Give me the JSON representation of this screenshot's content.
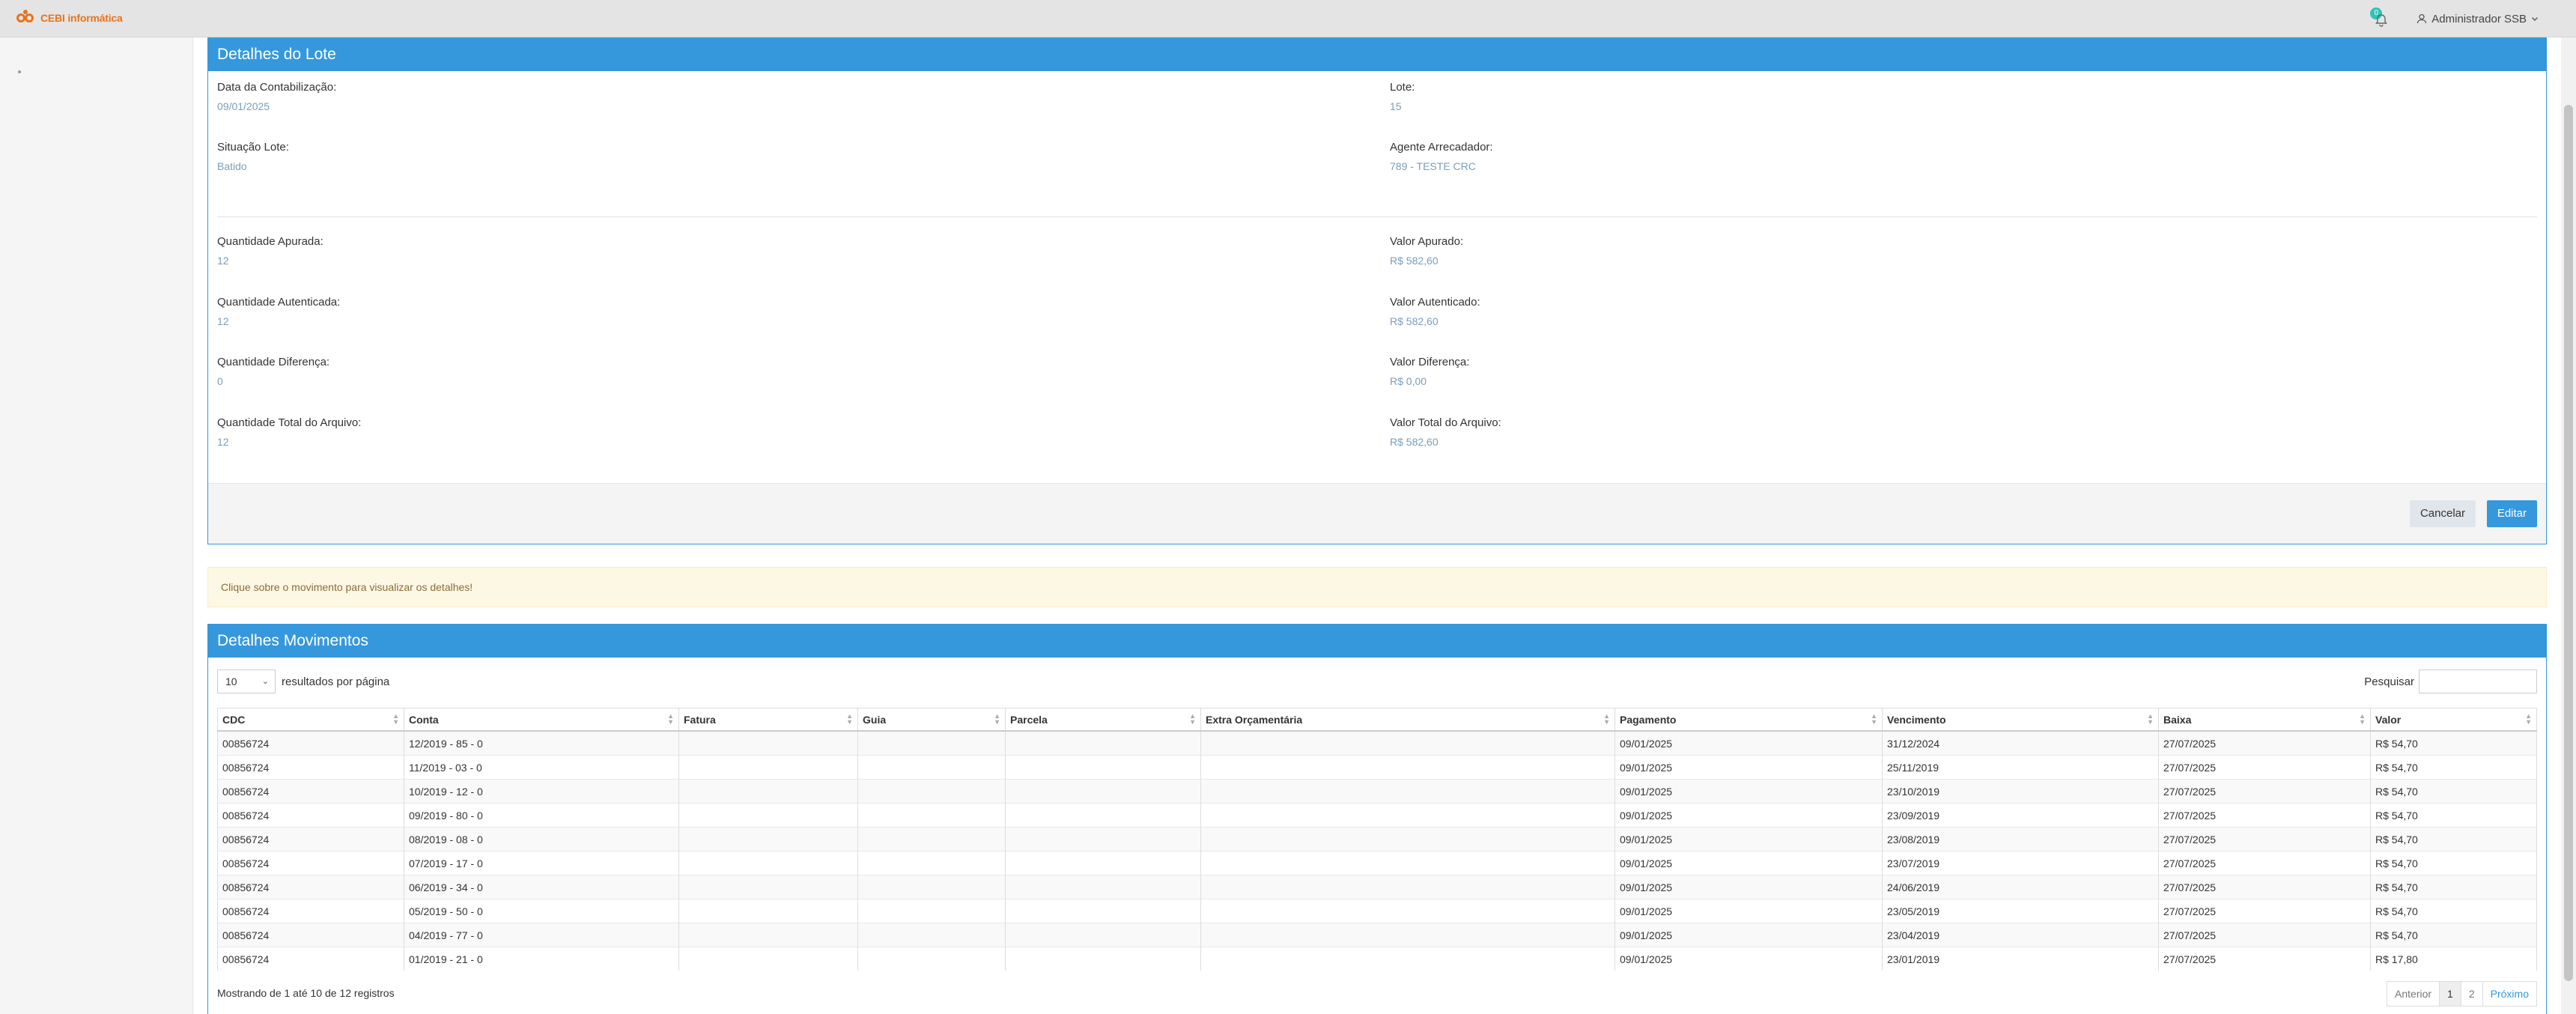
{
  "navbar": {
    "brand": "CEBI informática",
    "notification_count": "0",
    "user_name": "Administrador SSB"
  },
  "lote": {
    "title": "Detalhes do Lote",
    "fields": [
      {
        "label": "Data da Contabilização:",
        "value": "09/01/2025"
      },
      {
        "label": "Lote:",
        "value": "15"
      },
      {
        "label": "Situação Lote:",
        "value": "Batido"
      },
      {
        "label": "Agente Arrecadador:",
        "value": "789 - TESTE CRC"
      },
      {
        "label": "Quantidade Apurada:",
        "value": "12"
      },
      {
        "label": "Valor Apurado:",
        "value": "R$ 582,60"
      },
      {
        "label": "Quantidade Autenticada:",
        "value": "12"
      },
      {
        "label": "Valor Autenticado:",
        "value": "R$ 582,60"
      },
      {
        "label": "Quantidade Diferença:",
        "value": "0"
      },
      {
        "label": "Valor Diferença:",
        "value": "R$ 0,00"
      },
      {
        "label": "Quantidade Total do Arquivo:",
        "value": "12"
      },
      {
        "label": "Valor Total do Arquivo:",
        "value": "R$ 582,60"
      }
    ],
    "cancel_label": "Cancelar",
    "edit_label": "Editar"
  },
  "alert_text": "Clique sobre o movimento para visualizar os detalhes!",
  "movimentos": {
    "title": "Detalhes Movimentos",
    "page_length": "10",
    "page_length_label": "resultados por página",
    "search_label": "Pesquisar",
    "columns": [
      "CDC",
      "Conta",
      "Fatura",
      "Guia",
      "Parcela",
      "Extra Orçamentária",
      "Pagamento",
      "Vencimento",
      "Baixa",
      "Valor"
    ],
    "rows": [
      [
        "00856724",
        "12/2019 - 85 - 0",
        "",
        "",
        "",
        "",
        "09/01/2025",
        "31/12/2024",
        "27/07/2025",
        "R$ 54,70"
      ],
      [
        "00856724",
        "11/2019 - 03 - 0",
        "",
        "",
        "",
        "",
        "09/01/2025",
        "25/11/2019",
        "27/07/2025",
        "R$ 54,70"
      ],
      [
        "00856724",
        "10/2019 - 12 - 0",
        "",
        "",
        "",
        "",
        "09/01/2025",
        "23/10/2019",
        "27/07/2025",
        "R$ 54,70"
      ],
      [
        "00856724",
        "09/2019 - 80 - 0",
        "",
        "",
        "",
        "",
        "09/01/2025",
        "23/09/2019",
        "27/07/2025",
        "R$ 54,70"
      ],
      [
        "00856724",
        "08/2019 - 08 - 0",
        "",
        "",
        "",
        "",
        "09/01/2025",
        "23/08/2019",
        "27/07/2025",
        "R$ 54,70"
      ],
      [
        "00856724",
        "07/2019 - 17 - 0",
        "",
        "",
        "",
        "",
        "09/01/2025",
        "23/07/2019",
        "27/07/2025",
        "R$ 54,70"
      ],
      [
        "00856724",
        "06/2019 - 34 - 0",
        "",
        "",
        "",
        "",
        "09/01/2025",
        "24/06/2019",
        "27/07/2025",
        "R$ 54,70"
      ],
      [
        "00856724",
        "05/2019 - 50 - 0",
        "",
        "",
        "",
        "",
        "09/01/2025",
        "23/05/2019",
        "27/07/2025",
        "R$ 54,70"
      ],
      [
        "00856724",
        "04/2019 - 77 - 0",
        "",
        "",
        "",
        "",
        "09/01/2025",
        "23/04/2019",
        "27/07/2025",
        "R$ 54,70"
      ],
      [
        "00856724",
        "01/2019 - 21 - 0",
        "",
        "",
        "",
        "",
        "09/01/2025",
        "23/01/2019",
        "27/07/2025",
        "R$ 17,80"
      ]
    ],
    "info": "Mostrando de 1 até 10 de 12 registros",
    "pager": {
      "prev": "Anterior",
      "pages": [
        "1",
        "2"
      ],
      "next": "Próximo"
    }
  }
}
